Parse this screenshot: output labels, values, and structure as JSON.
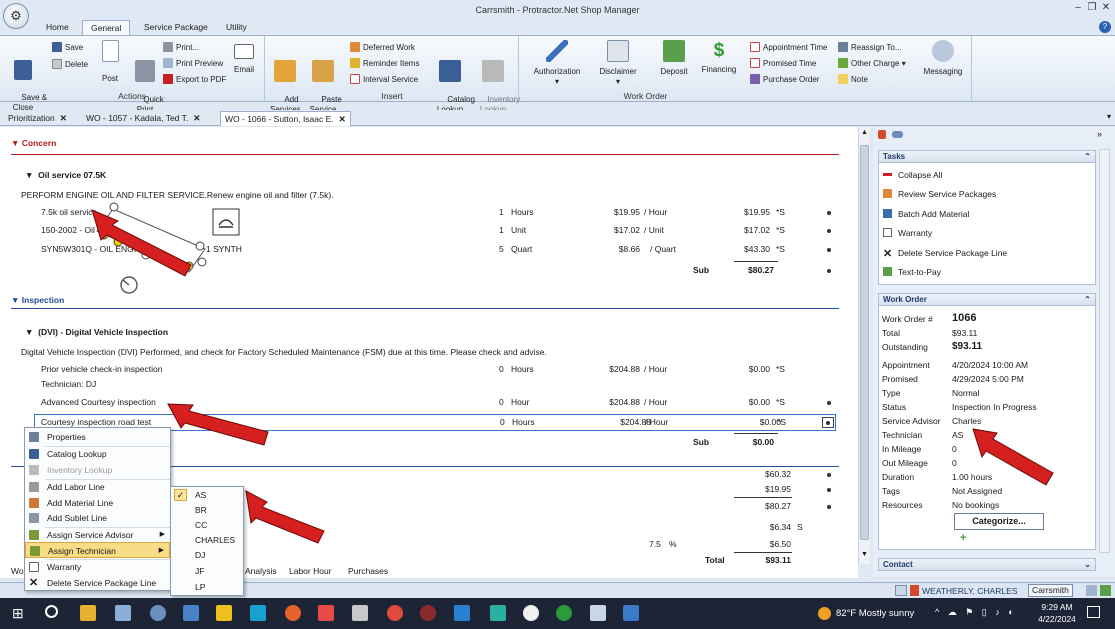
{
  "window": {
    "title": "Carrsmith - Protractor.Net Shop Manager"
  },
  "ribbon": {
    "tabs": [
      "Home",
      "General",
      "Service Package",
      "Utility"
    ],
    "active_tab": "General",
    "groups": {
      "actions": "Actions",
      "insert": "Insert",
      "work_order": "Work Order"
    },
    "buttons": {
      "save_close": "Save &\nClose",
      "save": "Save",
      "delete": "Delete",
      "post": "Post",
      "quick_print": "Quick\nPrint",
      "print": "Print...",
      "print_preview": "Print Preview",
      "export_pdf": "Export to PDF",
      "email": "Email",
      "add_services": "Add\nServices",
      "paste_service": "Paste\nService",
      "deferred_work": "Deferred Work",
      "reminder_items": "Reminder Items",
      "interval_service": "Interval Service",
      "catalog_lookup": "Catalog\nLookup",
      "inventory_lookup": "Inventory\nLookup",
      "authorization": "Authorization",
      "disclaimer": "Disclaimer",
      "deposit": "Deposit",
      "financing": "Financing",
      "appointment_time": "Appointment Time",
      "promised_time": "Promised Time",
      "purchase_order": "Purchase Order",
      "reassign_to": "Reassign To...",
      "other_charge": "Other Charge",
      "note": "Note",
      "messaging": "Messaging"
    }
  },
  "doc_tabs": [
    "Prioritization",
    "WO - 1057 - Kadala, Ted T.",
    "WO - 1066 - Sutton, Isaac E."
  ],
  "concern": {
    "header": "Concern",
    "package_title": "Oil service 07.5K",
    "description": "PERFORM ENGINE OIL AND FILTER SERVICE.Renew engine oil and filter (7.5k).",
    "lines": [
      {
        "desc": "7.5k oil service",
        "qty": "1",
        "unit": "Hours",
        "rate": "$19.95",
        "per": "/ Hour",
        "total": "$19.95",
        "flag": "*S"
      },
      {
        "desc": "150-2002 - Oil",
        "qty": "1",
        "unit": "Unit",
        "rate": "$17.02",
        "per": "/ Unit",
        "total": "$17.02",
        "flag": "*S"
      },
      {
        "desc": "SYN5W301Q - OIL ENGI",
        "desc_tail": "1 SYNTH",
        "qty": "5",
        "unit": "Quart",
        "rate": "$8.66",
        "per": "/ Quart",
        "total": "$43.30",
        "flag": "*S"
      }
    ],
    "sub_label": "Sub",
    "sub_total": "$80.27"
  },
  "inspection": {
    "header": "Inspection",
    "package_title": "(DVI) - Digital Vehicle Inspection",
    "description": "Digital Vehicle Inspection (DVI) Performed, and check for Factory Scheduled Maintenance (FSM) due at this time. Please check and advise.",
    "lines": [
      {
        "desc": "Prior vehicle check-in inspection",
        "tech": "Technician: DJ",
        "qty": "0",
        "unit": "Hours",
        "rate": "$204.88",
        "per": "/ Hour",
        "total": "$0.00",
        "flag": "*S"
      },
      {
        "desc": "Advanced Courtesy inspection",
        "qty": "0",
        "unit": "Hour",
        "rate": "$204.88",
        "per": "/ Hour",
        "total": "$0.00",
        "flag": "*S"
      },
      {
        "desc": "Courtesy inspection road test",
        "qty": "0",
        "unit": "Hours",
        "rate": "$204.88",
        "per": "/ Hour",
        "total": "$0.00",
        "flag": "*S"
      }
    ],
    "sub_label": "Sub",
    "sub_total": "$0.00"
  },
  "summary": {
    "v1": "$60.32",
    "v2": "$19.95",
    "v3": "$80.27",
    "v4": "$6.34",
    "v4_flag": "S",
    "tax_rate": "7.5",
    "tax_pct": "%",
    "v5": "$6.50",
    "total_label": "Total",
    "total": "$93.11"
  },
  "bottom_tabs": [
    "Wo",
    "Analysis",
    "Labor Hour",
    "Purchases"
  ],
  "tasks": {
    "header": "Tasks",
    "items": [
      "Collapse All",
      "Review Service Packages",
      "Batch Add Material",
      "Warranty",
      "Delete Service Package Line",
      "Text-to-Pay"
    ]
  },
  "work_order": {
    "header": "Work Order",
    "fields": [
      {
        "k": "Work Order #",
        "v": "1066"
      },
      {
        "k": "Total",
        "v": "$93.11"
      },
      {
        "k": "Outstanding",
        "v": "$93.11"
      },
      {
        "k": "Appointment",
        "v": "4/20/2024 10:00 AM"
      },
      {
        "k": "Promised",
        "v": "4/29/2024 5:00 PM"
      },
      {
        "k": "Type",
        "v": "Normal"
      },
      {
        "k": "Status",
        "v": "Inspection In Progress"
      },
      {
        "k": "Service Advisor",
        "v": "Charles"
      },
      {
        "k": "Technician",
        "v": "AS"
      },
      {
        "k": "In Mileage",
        "v": "0"
      },
      {
        "k": "Out Mileage",
        "v": "0"
      },
      {
        "k": "Duration",
        "v": "1.00 hours"
      },
      {
        "k": "Tags",
        "v": "Not Assigned"
      },
      {
        "k": "Resources",
        "v": "No bookings"
      }
    ],
    "categorize": "Categorize..."
  },
  "contact": {
    "header": "Contact"
  },
  "status": {
    "user": "WEATHERLY, CHARLES",
    "shop": "Carrsmith"
  },
  "context_menu": {
    "items": [
      "Properties",
      "Catalog Lookup",
      "Inventory Lookup",
      "Add Labor Line",
      "Add Material Line",
      "Add Sublet Line",
      "Assign Service Advisor",
      "Assign Technician",
      "Warranty",
      "Delete Service Package Line"
    ],
    "submenu": [
      "AS",
      "BR",
      "CC",
      "CHARLES",
      "DJ",
      "JF",
      "LP"
    ],
    "checked": "AS"
  },
  "taskbar": {
    "weather": "82°F  Mostly sunny",
    "time": "9:29 AM",
    "date": "4/22/2024"
  },
  "colors": {
    "accent": "#2a62b3",
    "section_red": "#b21b1b",
    "section_blue": "#1f4f9e",
    "arrow": "#d61f1f",
    "highlight": "#f9dd86"
  }
}
